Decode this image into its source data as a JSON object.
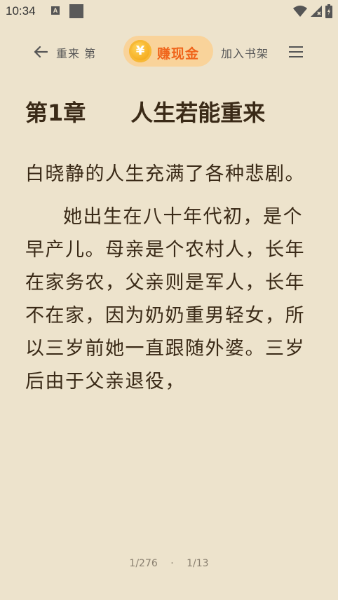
{
  "status_bar": {
    "time": "10:34",
    "a_badge": "A"
  },
  "toolbar": {
    "title": "重来 第",
    "cash_label": "赚现金",
    "coin_glyph": "¥",
    "shelf_label": "加入书架"
  },
  "chapter": {
    "title": "第1章　　人生若能重来",
    "paragraphs": [
      "白晓静的人生充满了各种悲剧。",
      "她出生在八十年代初，是个早产儿。母亲是个农村人，长年在家务农，父亲则是军人，长年不在家，因为奶奶重男轻女，所以三岁前她一直跟随外婆。三岁后由于父亲退役，"
    ]
  },
  "footer": {
    "page_progress": "1/276",
    "chapter_progress": "1/13"
  },
  "colors": {
    "background": "#ede3cc",
    "accent": "#f0651b",
    "cash_bg": "#f9d39a",
    "text": "#3a2a17"
  }
}
